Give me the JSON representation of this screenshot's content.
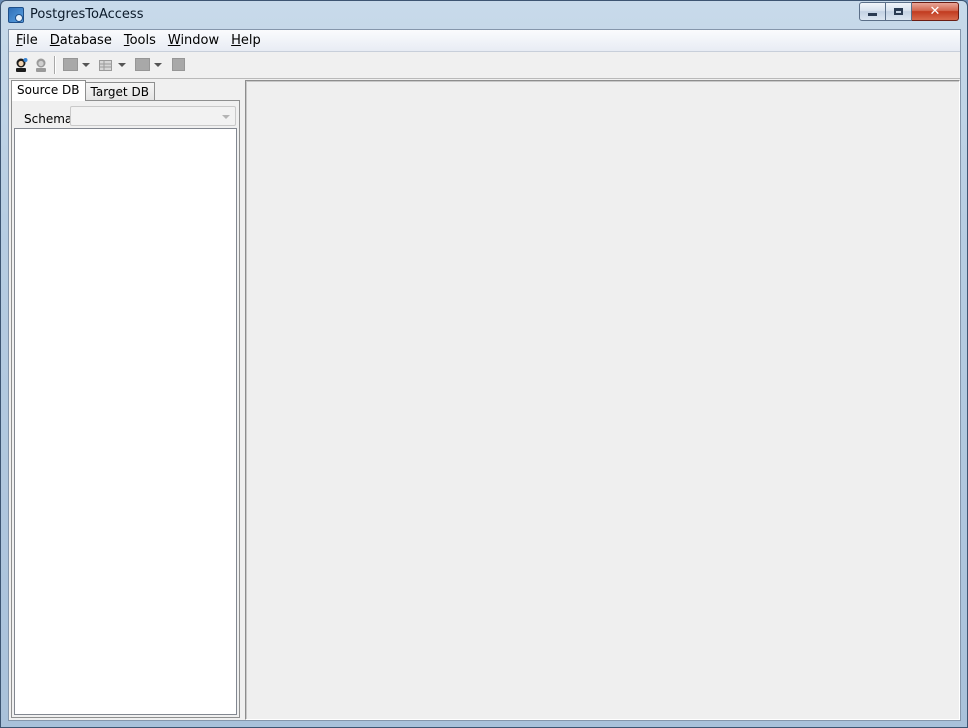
{
  "window": {
    "title": "PostgresToAccess"
  },
  "menu": [
    {
      "prefix": "",
      "accel": "F",
      "rest": "ile"
    },
    {
      "prefix": "",
      "accel": "D",
      "rest": "atabase"
    },
    {
      "prefix": "",
      "accel": "T",
      "rest": "ools"
    },
    {
      "prefix": "",
      "accel": "W",
      "rest": "indow"
    },
    {
      "prefix": "",
      "accel": "H",
      "rest": "elp"
    }
  ],
  "toolbar": {
    "icons": [
      "connect-icon",
      "disconnect-icon",
      "export-icon",
      "table-icon",
      "run-icon",
      "stop-icon"
    ]
  },
  "left_panel": {
    "tabs": [
      {
        "label": "Source DB",
        "active": true
      },
      {
        "label": "Target DB",
        "active": false
      }
    ],
    "schema_label": "Schema",
    "schema_value": ""
  }
}
